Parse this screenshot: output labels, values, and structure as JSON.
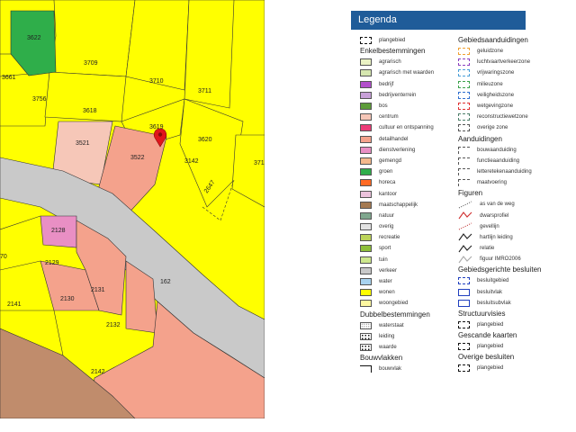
{
  "map": {
    "parcels": [
      "3622",
      "3709",
      "3661",
      "3710",
      "3756",
      "3711",
      "3618",
      "3619",
      "3521",
      "3620",
      "3522",
      "3142",
      "371",
      "2647",
      "2128",
      "2129",
      "2131",
      "2130",
      "2141",
      "162",
      "2132",
      "2142",
      "70"
    ],
    "marker": "red-location-pin"
  },
  "legend": {
    "title": "Legenda",
    "header_color": "#1f5c99",
    "left_sections": [
      {
        "items": [
          {
            "label": "plangebied",
            "color": "#ffffff",
            "style": "dashed-black"
          }
        ]
      },
      {
        "title": "Enkelbestemmingen",
        "items": [
          {
            "label": "agrarisch",
            "color": "#eaf2c4"
          },
          {
            "label": "agrarisch met waarden",
            "color": "#d6e7b0"
          },
          {
            "label": "bedrijf",
            "color": "#b34fcc"
          },
          {
            "label": "bedrijventerrein",
            "color": "#c8a0d8"
          },
          {
            "label": "bos",
            "color": "#5d9c3a"
          },
          {
            "label": "centrum",
            "color": "#f6c7b8"
          },
          {
            "label": "cultuur en ontspanning",
            "color": "#ec3c78"
          },
          {
            "label": "detailhandel",
            "color": "#f4a28c"
          },
          {
            "label": "dienstverlening",
            "color": "#e98fc4"
          },
          {
            "label": "gemengd",
            "color": "#f5b98d"
          },
          {
            "label": "groen",
            "color": "#2fae4a"
          },
          {
            "label": "horeca",
            "color": "#ff6a24"
          },
          {
            "label": "kantoor",
            "color": "#ebc2dc"
          },
          {
            "label": "maatschappelijk",
            "color": "#a47a52"
          },
          {
            "label": "natuur",
            "color": "#7fa78e"
          },
          {
            "label": "overig",
            "color": "#e2e2e2"
          },
          {
            "label": "recreatie",
            "color": "#bcd35a"
          },
          {
            "label": "sport",
            "color": "#8dbf3a"
          },
          {
            "label": "tuin",
            "color": "#cde88d"
          },
          {
            "label": "verkeer",
            "color": "#c9c9c9"
          },
          {
            "label": "water",
            "color": "#a8d3ef"
          },
          {
            "label": "wonen",
            "color": "#ffff00"
          },
          {
            "label": "woongebied",
            "color": "#fdf7a0"
          }
        ]
      },
      {
        "title": "Dubbelbestemmingen",
        "items": [
          {
            "label": "waterstaat",
            "color": "#ffffff",
            "style": "dotted-light"
          },
          {
            "label": "leiding",
            "color": "#ffffff",
            "style": "dotted-dark"
          },
          {
            "label": "waarde",
            "color": "#ffffff",
            "style": "dotted-dark"
          }
        ]
      },
      {
        "title": "Bouwvlakken",
        "items": [
          {
            "label": "bouwvlak",
            "color": "#ffffff",
            "style": "bouwvlak-line"
          }
        ]
      }
    ],
    "right_sections": [
      {
        "title": "Gebiedsaanduidingen",
        "items": [
          {
            "label": "geluidzone",
            "color": "#f0a030",
            "style": "dashed-color"
          },
          {
            "label": "luchtvaartverkeerzone",
            "color": "#8a3fbf",
            "style": "dashed-color"
          },
          {
            "label": "vrijwaringszone",
            "color": "#4a9fd8",
            "style": "dashed-color"
          },
          {
            "label": "milieuzone",
            "color": "#3aa24a",
            "style": "dashed-color"
          },
          {
            "label": "veiligheidszone",
            "color": "#2f6fd0",
            "style": "dashed-color"
          },
          {
            "label": "wetgevingzone",
            "color": "#e03030",
            "style": "dashed-color"
          },
          {
            "label": "reconstructiewetzone",
            "color": "#4e7f6a",
            "style": "dashed-color"
          },
          {
            "label": "overige zone",
            "color": "#555555",
            "style": "dashed-color"
          }
        ]
      },
      {
        "title": "Aanduidingen",
        "items": [
          {
            "label": "bouwaanduiding",
            "color": "#555555",
            "style": "dashed-open"
          },
          {
            "label": "functieaanduiding",
            "color": "#555555",
            "style": "dashed-open"
          },
          {
            "label": "letteretekenaanduiding",
            "color": "#555555",
            "style": "dashed-open"
          },
          {
            "label": "maatvoering",
            "color": "#555555",
            "style": "dashed-open"
          }
        ]
      },
      {
        "title": "Figuren",
        "items": [
          {
            "label": "as van de weg",
            "color": "#555555",
            "style": "fig-dotted"
          },
          {
            "label": "dwarsprofiel",
            "color": "#d03030",
            "style": "fig-zigzag"
          },
          {
            "label": "gevellijn",
            "color": "#c03030",
            "style": "fig-dotted-red"
          },
          {
            "label": "hartlijn leiding",
            "color": "#222222",
            "style": "fig-zigzag"
          },
          {
            "label": "relatie",
            "color": "#222222",
            "style": "fig-zigzag"
          },
          {
            "label": "figuur IMRO2006",
            "color": "#aaaaaa",
            "style": "fig-zigzag"
          }
        ]
      },
      {
        "title": "Gebiedsgerichte besluiten",
        "items": [
          {
            "label": "besluitgebied",
            "color": "#1f3fbf",
            "style": "dashed-blue"
          },
          {
            "label": "besluitvlak",
            "color": "#1f3fbf",
            "style": "solid-blue"
          },
          {
            "label": "besluitsubvlak",
            "color": "#1f3fbf",
            "style": "solid-blue"
          }
        ]
      },
      {
        "title": "Structuurvisies",
        "items": [
          {
            "label": "plangebied",
            "color": "#ffffff",
            "style": "dashed-black"
          }
        ]
      },
      {
        "title": "Gescande kaarten",
        "items": [
          {
            "label": "plangebied",
            "color": "#ffffff",
            "style": "dashed-black"
          }
        ]
      },
      {
        "title": "Overige besluiten",
        "items": [
          {
            "label": "plangebied",
            "color": "#ffffff",
            "style": "dashed-black"
          }
        ]
      }
    ]
  }
}
